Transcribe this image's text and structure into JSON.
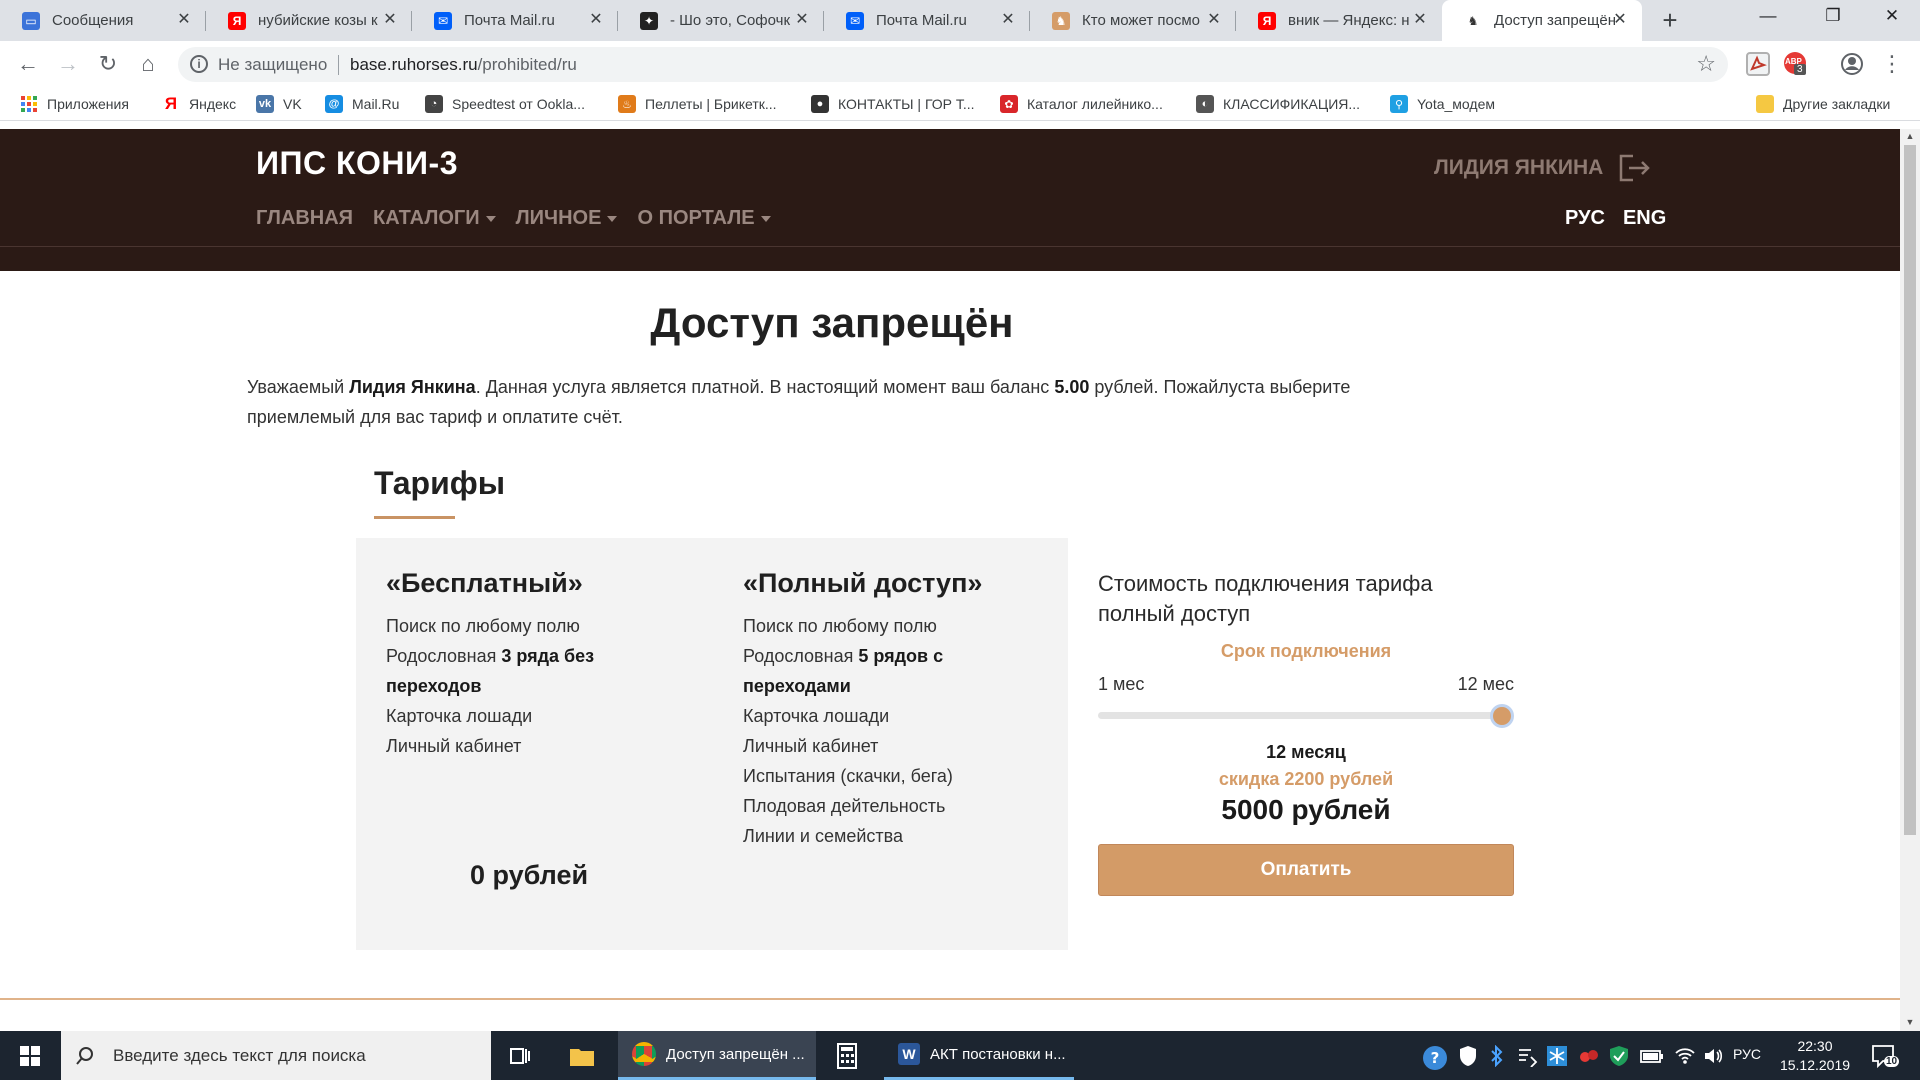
{
  "browser": {
    "tabs": [
      {
        "title": "Сообщения",
        "favicon_color": "#3b73d9",
        "favicon_glyph": "▭"
      },
      {
        "title": "нубийские козы к",
        "favicon_color": "#ff0000",
        "favicon_glyph": "Я"
      },
      {
        "title": "Почта Mail.ru",
        "favicon_color": "#005ff9",
        "favicon_glyph": "✉"
      },
      {
        "title": "- Шо это, Софочк",
        "favicon_color": "#222222",
        "favicon_glyph": "✦"
      },
      {
        "title": "Почта Mail.ru",
        "favicon_color": "#005ff9",
        "favicon_glyph": "✉"
      },
      {
        "title": "Кто может посмо",
        "favicon_color": "#d59c68",
        "favicon_glyph": "♞"
      },
      {
        "title": "вник — Яндекс: н",
        "favicon_color": "#ff0000",
        "favicon_glyph": "Я"
      },
      {
        "title": "Доступ запрещён",
        "favicon_color": "#ffffff",
        "favicon_glyph": "♞",
        "active": true
      }
    ],
    "new_tab_glyph": "+",
    "close_glyph": "✕",
    "window": {
      "minimize": "—",
      "maximize": "❐",
      "close": "✕"
    },
    "nav": {
      "back": "←",
      "forward": "→",
      "reload": "↻",
      "home": "⌂"
    },
    "address": {
      "security_label": "Не защищено",
      "domain": "base.ruhorses.ru",
      "path": "/prohibited/ru",
      "bookmark_star": "☆"
    },
    "extensions": {
      "abp_badge": "3",
      "abp_label": "ABP"
    },
    "bookmarks": [
      {
        "label": "Приложения",
        "icon": "apps-grid-icon",
        "color": "#e94235"
      },
      {
        "label": "Яндекс",
        "icon": "yandex-icon",
        "color": "#ff0000",
        "glyph": "Я"
      },
      {
        "label": "VK",
        "icon": "vk-icon",
        "color": "#4a76a8",
        "glyph": "vk"
      },
      {
        "label": "Mail.Ru",
        "icon": "mailru-icon",
        "color": "#168de2",
        "glyph": "@"
      },
      {
        "label": "Speedtest от Ookla...",
        "icon": "speedtest-icon",
        "color": "#444444",
        "glyph": "◔"
      },
      {
        "label": "Пеллеты | Брикетк...",
        "icon": "pellets-icon",
        "color": "#e07b1a",
        "glyph": "♨"
      },
      {
        "label": "КОНТАКТЫ | ГОР Т...",
        "icon": "contacts-icon",
        "color": "#333333",
        "glyph": "●"
      },
      {
        "label": "Каталог лилейнико...",
        "icon": "lily-catalog-icon",
        "color": "#d9262a",
        "glyph": "✿"
      },
      {
        "label": "КЛАССИФИКАЦИЯ...",
        "icon": "classification-icon",
        "color": "#555555",
        "glyph": "◐"
      },
      {
        "label": "Yota_модем",
        "icon": "yota-icon",
        "color": "#1fa0e3",
        "glyph": "⚲"
      }
    ],
    "other_bookmarks": "Другие закладки"
  },
  "site": {
    "logo": "ИПС КОНИ-3",
    "user_name": "ЛИДИЯ ЯНКИНА",
    "nav": [
      {
        "label": "ГЛАВНАЯ",
        "has_dropdown": false
      },
      {
        "label": "КАТАЛОГИ",
        "has_dropdown": true
      },
      {
        "label": "ЛИЧНОЕ",
        "has_dropdown": true
      },
      {
        "label": "О ПОРТАЛЕ",
        "has_dropdown": true
      }
    ],
    "languages": [
      "РУС",
      "ENG"
    ]
  },
  "page": {
    "title": "Доступ запрещён",
    "intro": {
      "p1": "Уважаемый ",
      "name": "Лидия Янкина",
      "p2": ". Данная услуга является платной. В настоящий момент ваш баланс ",
      "balance": "5.00",
      "p3": " рублей. Пожайлуста выберите приемлемый для вас тариф и оплатите счёт."
    },
    "tariffs_heading": "Тарифы",
    "plans": [
      {
        "name": "«Бесплатный»",
        "features": [
          {
            "text": "Поиск по любому полю"
          },
          {
            "text": "Родословная ",
            "bold": "3 ряда без переходов"
          },
          {
            "text": "Карточка лошади"
          },
          {
            "text": "Личный кабинет"
          }
        ],
        "price": "0 рублей"
      },
      {
        "name": "«Полный доступ»",
        "features": [
          {
            "text": "Поиск по любому полю"
          },
          {
            "text": "Родословная ",
            "bold": "5 рядов с переходами"
          },
          {
            "text": "Карточка лошади"
          },
          {
            "text": "Личный кабинет"
          },
          {
            "text": "Испытания (скачки, бега)"
          },
          {
            "text": "Плодовая дейтельность"
          },
          {
            "text": "Линии и семейства"
          }
        ]
      }
    ],
    "cost": {
      "title": "Стоимость подключения тарифа полный доступ",
      "term_label": "Срок подключения",
      "range_min": "1 мес",
      "range_max": "12 мес",
      "slider_min": 1,
      "slider_max": 12,
      "slider_value": 12,
      "months": "12 месяц",
      "discount": "скидка 2200 рублей",
      "total": "5000 рублей",
      "pay_button": "Оплатить"
    },
    "accent_color": "#d59c68",
    "header_color": "#2b1a15"
  },
  "taskbar": {
    "search_placeholder": "Введите здесь текст для поиска",
    "apps": [
      {
        "title": "Доступ запрещён ...",
        "active": true
      },
      {
        "title": "АКТ постановки н..."
      }
    ],
    "tray": {
      "lang": "РУС",
      "notifications": "10"
    },
    "clock": {
      "time": "22:30",
      "date": "15.12.2019"
    }
  }
}
